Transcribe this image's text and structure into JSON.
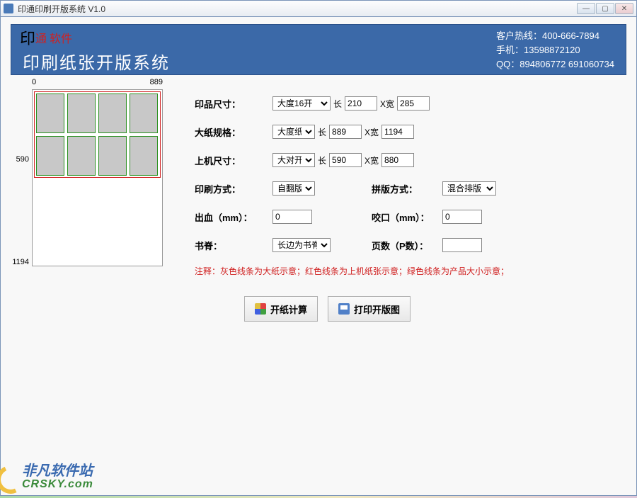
{
  "window": {
    "title": "印通印刷开版系统 V1.0",
    "min": "—",
    "max": "▢",
    "close": "✕"
  },
  "header": {
    "logo_black": "印",
    "logo_red": "通 软件",
    "title": "印刷纸张开版系统",
    "hotline_label": "客户热线：",
    "hotline": "400-666-7894",
    "mobile_label": "手机：",
    "mobile": "13598872120",
    "qq_label": "QQ：",
    "qq": "894806772   691060734"
  },
  "preview": {
    "top_left": "0",
    "top_right": "889",
    "left_mid": "590",
    "left_bottom": "1194"
  },
  "form": {
    "product_size_label": "印品尺寸：",
    "product_size_sel": "大度16开",
    "len_label": "长",
    "wid_label": "X宽",
    "product_len": "210",
    "product_wid": "285",
    "paper_spec_label": "大纸规格：",
    "paper_spec_sel": "大度纸",
    "paper_len": "889",
    "paper_wid": "1194",
    "machine_size_label": "上机尺寸：",
    "machine_size_sel": "大对开",
    "machine_len": "590",
    "machine_wid": "880",
    "print_mode_label": "印刷方式：",
    "print_mode_sel": "自翻版",
    "layout_mode_label": "拼版方式：",
    "layout_mode_sel": "混合排版",
    "bleed_label": "出血（mm）：",
    "bleed_val": "0",
    "grip_label": "咬口（mm）：",
    "grip_val": "0",
    "spine_label": "书脊：",
    "spine_sel": "长边为书脊",
    "pages_label": "页数（P数）：",
    "pages_val": "",
    "note": "注释：灰色线条为大纸示意；红色线条为上机纸张示意；绿色线条为产品大小示意；"
  },
  "buttons": {
    "calc": "开纸计算",
    "print": "打印开版图"
  },
  "watermark": {
    "cn": "非凡软件站",
    "en": "CRSKY.com"
  }
}
